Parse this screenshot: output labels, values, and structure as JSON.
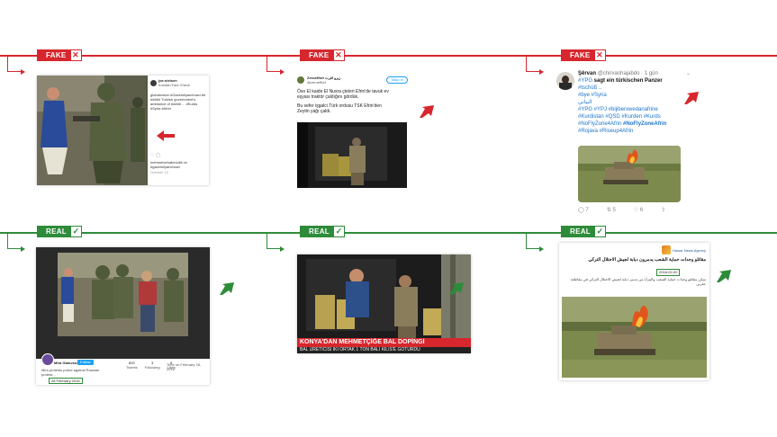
{
  "labels": {
    "fake": "FAKE",
    "real": "REAL",
    "x_mark": "✕",
    "check_mark": "✓"
  },
  "colors": {
    "fake": "#d7262d",
    "real": "#2e8b3a"
  },
  "fake1": {
    "handle": "joe.nielsen",
    "verified_sub": "Kurdish Fact Check",
    "follow": "Follow",
    "body": "globalvision #Gacemilyanchowi ## ##### Turkish government's ambiance of ##### ... #Kurds #Syria #Afrin",
    "footer": "mehmetcehabercilik ve #gacemilyanchowi",
    "date": "October 12"
  },
  "fake2": {
    "name": "Zeroeffort",
    "arabic_name": "زيرو افرت",
    "handle": "@zeroeffort",
    "follow": "Takip et",
    "line1": "Öso El kaide El Nusra çteleri Efrin'de tavuk ev",
    "line2": "eşyası traktör çaldığını gördük.",
    "line3": "Bu sefer işgalci Türk ordusu TSK Efrin'den",
    "line4": "Zeytin yağı çaldı."
  },
  "fake3": {
    "name": "Şêrvan",
    "handle": "@chirvanhajabdo",
    "time": "· 1 gün",
    "tags1": "#YPG",
    "text1": " sagt ein türkischen Panzer",
    "tags2": "#tschüß ..",
    "tags3": "#bye #Syria",
    "tags4": "#YPG #YPJ #bijiberxwedanafrine",
    "tags5": "#Kurdistan #QSD #Kurden #Kurds",
    "tags6": "#NoFlyZone4Afrin",
    "tags6b": "#NoFlyZoneAfrin",
    "tags7": "#Rojava #Riseup4Afrin",
    "arabic": "البياني",
    "reply_count": "7",
    "retweet_count": "5",
    "like_count": "6"
  },
  "real1": {
    "channel": "Mira Gatovsos",
    "follow": "Follow",
    "stat1_label": "Tweets",
    "stat1": "829",
    "stat2_label": "Following",
    "stat2": "3",
    "stat3_label": "Likes",
    "stat3": "8",
    "joined": "Time on February 28, 2016",
    "desc": "Mira protests police against Russian protest...",
    "date_box": "28 February 2016"
  },
  "real2": {
    "headline": "KONYA'DAN MEHMETÇİĞE BAL DOPİNGİ",
    "subline": "BAL ÜRETİCİSİ İKİ ORTAK 1 TON BALI KİLİS'E GÖTÜRDÜ"
  },
  "real3": {
    "agency": "Hawar News Agency",
    "arabic_title": "مقاتلو وحدات حماية الشعب يدمرون دبابة لجيش الاحتلال التركي",
    "date_box": "2018-02-02",
    "body_ar": "تمكن مقاتلو وحدات حماية الشعب والمرأة من تدمير دبابة لجيش الاحتلال التركي في مقاطعة عفرين"
  }
}
